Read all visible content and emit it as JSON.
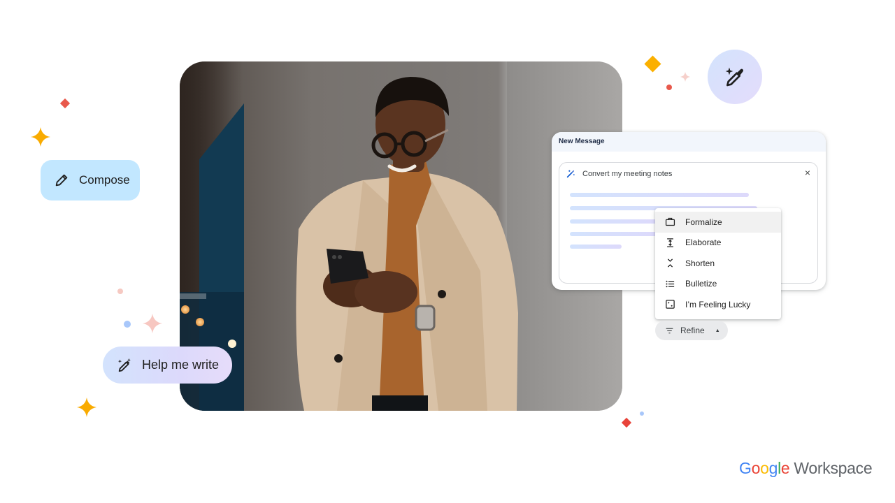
{
  "chips": {
    "compose": {
      "label": "Compose",
      "icon": "pencil-icon"
    },
    "help_me_write": {
      "label": "Help me write",
      "icon": "magic-pen-icon"
    },
    "magic_circle": {
      "icon": "magic-pen-icon"
    }
  },
  "compose_window": {
    "title": "New Message",
    "prompt": {
      "icon": "magic-pen-icon",
      "text": "Convert my meeting notes",
      "close_label": "×"
    }
  },
  "refine_menu": {
    "items": [
      {
        "label": "Formalize",
        "icon": "briefcase-icon",
        "active": true
      },
      {
        "label": "Elaborate",
        "icon": "expand-vertical-icon",
        "active": false
      },
      {
        "label": "Shorten",
        "icon": "collapse-vertical-icon",
        "active": false
      },
      {
        "label": "Bulletize",
        "icon": "list-bullet-icon",
        "active": false
      },
      {
        "label": "I’m Feeling Lucky",
        "icon": "dice-icon",
        "active": false
      }
    ],
    "button": {
      "label": "Refine",
      "icon": "filter-icon",
      "caret": "▲"
    }
  },
  "logo": {
    "google_letters": [
      {
        "char": "G",
        "color": "#4285F4"
      },
      {
        "char": "o",
        "color": "#EA4335"
      },
      {
        "char": "o",
        "color": "#FBBC04"
      },
      {
        "char": "g",
        "color": "#4285F4"
      },
      {
        "char": "l",
        "color": "#34A853"
      },
      {
        "char": "e",
        "color": "#EA4335"
      }
    ],
    "product": "Workspace"
  },
  "colors": {
    "google_blue": "#4285F4",
    "google_red": "#EA4335",
    "google_yellow": "#FBBC04",
    "google_green": "#34A853",
    "compose_chip_bg": "#C2E7FF",
    "sparkle_yellow": "#F9AB00",
    "diamond_red": "#E8584B"
  }
}
